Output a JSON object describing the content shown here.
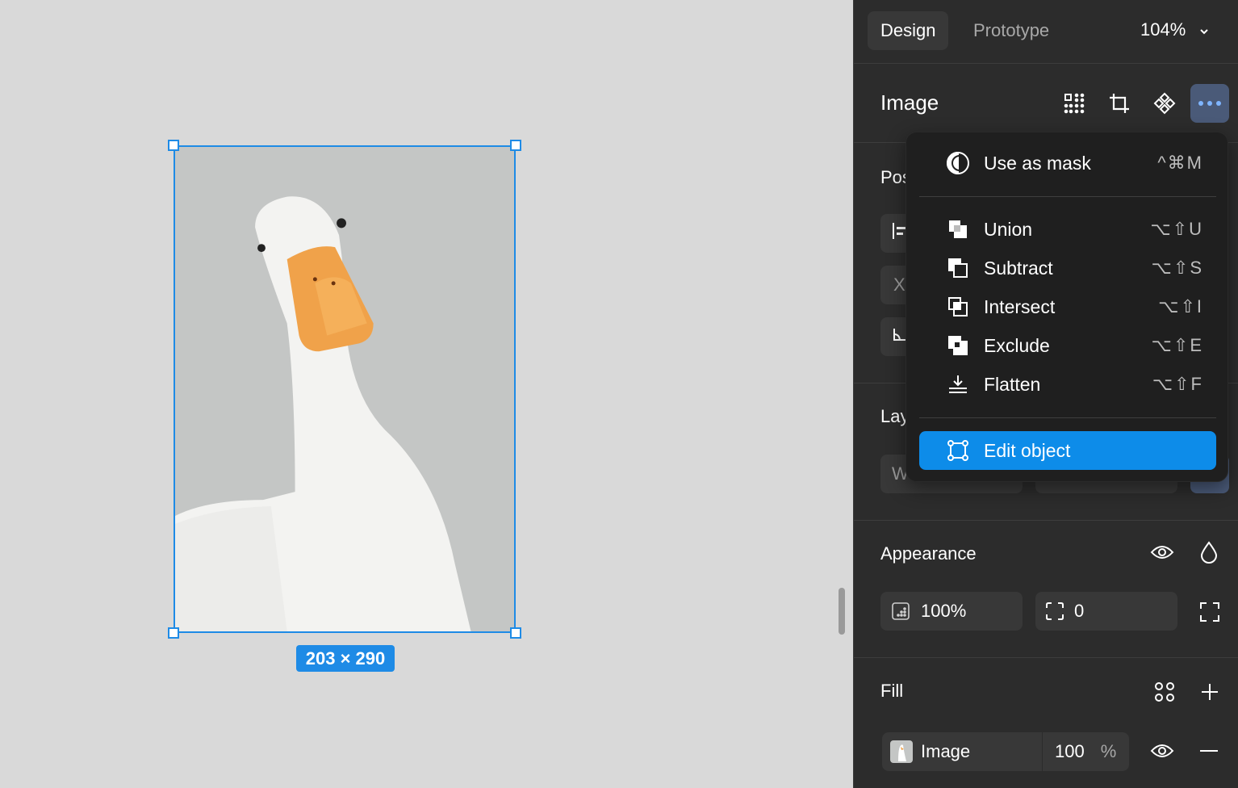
{
  "canvas": {
    "selection_size": "203 × 290"
  },
  "tabs": [
    {
      "label": "Design",
      "active": true
    },
    {
      "label": "Prototype",
      "active": false
    }
  ],
  "zoom": "104%",
  "image_section": {
    "title": "Image",
    "icons": [
      "grid-icon",
      "crop-icon",
      "component-icon",
      "more-icon"
    ]
  },
  "partial_labels": {
    "position": "Pos",
    "layout": "Lay",
    "x_field": "X",
    "w_field": "W"
  },
  "menu": {
    "items": [
      {
        "label": "Use as mask",
        "shortcut": "^⌘M",
        "icon": "mask-icon"
      },
      {
        "label": "Union",
        "shortcut": "⌥⇧U",
        "icon": "union-icon"
      },
      {
        "label": "Subtract",
        "shortcut": "⌥⇧S",
        "icon": "subtract-icon"
      },
      {
        "label": "Intersect",
        "shortcut": "⌥⇧I",
        "icon": "intersect-icon"
      },
      {
        "label": "Exclude",
        "shortcut": "⌥⇧E",
        "icon": "exclude-icon"
      },
      {
        "label": "Flatten",
        "shortcut": "⌥⇧F",
        "icon": "flatten-icon"
      },
      {
        "label": "Edit object",
        "shortcut": "",
        "icon": "edit-object-icon",
        "highlighted": true
      }
    ]
  },
  "appearance": {
    "title": "Appearance",
    "opacity": "100%",
    "radius": "0"
  },
  "fill": {
    "title": "Fill",
    "type": "Image",
    "opacity": "100",
    "unit": "%"
  },
  "colors": {
    "accent": "#0d8ce9",
    "selection": "#1e8be6",
    "panel_bg": "#2c2c2c",
    "canvas_bg": "#d9d9d9"
  }
}
